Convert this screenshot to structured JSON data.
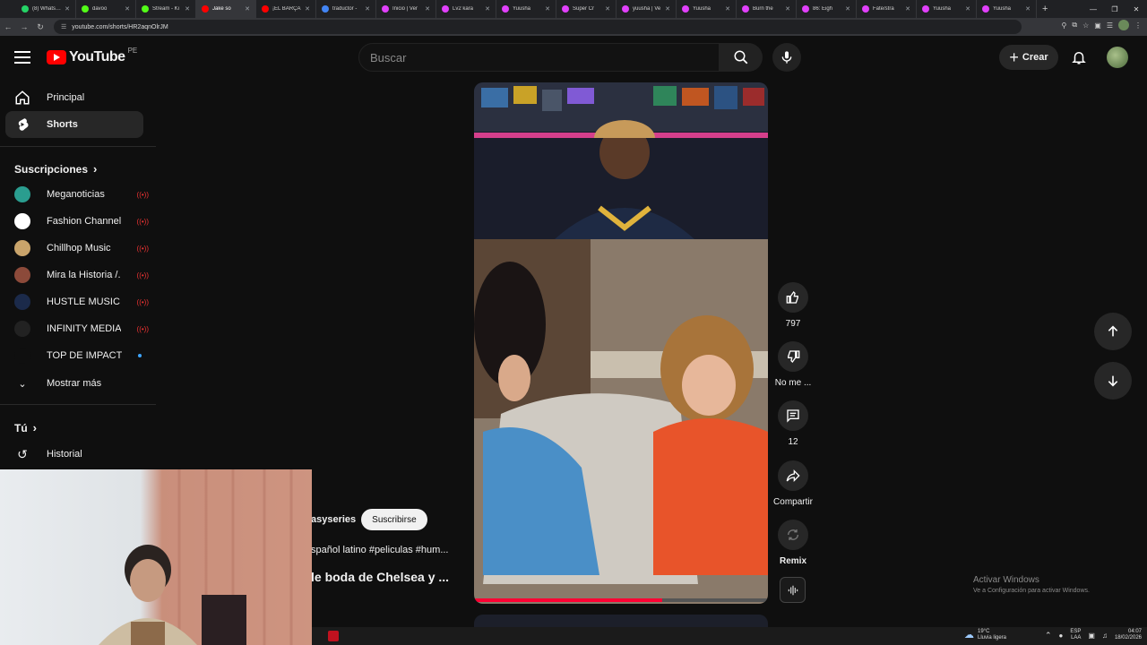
{
  "browser": {
    "tabs": [
      {
        "label": "(8) WhatsApp",
        "color": "#25d366"
      },
      {
        "label": "davoo",
        "color": "#53fc18"
      },
      {
        "label": "Stream - Ki",
        "color": "#53fc18"
      },
      {
        "label": "Jake so",
        "color": "#ff0000",
        "active": true
      },
      {
        "label": "¡EL BARÇA",
        "color": "#ff0000"
      },
      {
        "label": "traductor -",
        "color": "#4285f4"
      },
      {
        "label": "Inicio | Ver",
        "color": "#e040fb"
      },
      {
        "label": "Lv2 kara",
        "color": "#e040fb"
      },
      {
        "label": "Yuusha",
        "color": "#e040fb"
      },
      {
        "label": "Super Cr",
        "color": "#e040fb"
      },
      {
        "label": "yuusha | Ve",
        "color": "#e040fb"
      },
      {
        "label": "Yuusha",
        "color": "#e040fb"
      },
      {
        "label": "Burn the",
        "color": "#e040fb"
      },
      {
        "label": "86: Eigh",
        "color": "#e040fb"
      },
      {
        "label": "Fate/stra",
        "color": "#e040fb"
      },
      {
        "label": "Yuusha",
        "color": "#e040fb"
      },
      {
        "label": "Yuusha",
        "color": "#e040fb"
      }
    ],
    "url": "youtube.com/shorts/HR2aqnOlrJM"
  },
  "header": {
    "logo_text": "YouTube",
    "region": "PE",
    "search_placeholder": "Buscar",
    "create_label": "Crear"
  },
  "sidebar": {
    "main": [
      {
        "label": "Principal",
        "icon": "home-icon"
      },
      {
        "label": "Shorts",
        "icon": "shorts-icon",
        "selected": true
      }
    ],
    "subscriptions_title": "Suscripciones",
    "subscriptions": [
      {
        "name": "Meganoticias",
        "color": "#2a9d8f",
        "status": "live"
      },
      {
        "name": "Fashion Channel",
        "color": "#ffffff",
        "status": "live"
      },
      {
        "name": "Chillhop Music",
        "color": "#c9a46b",
        "status": "live"
      },
      {
        "name": "Mira la Historia /...",
        "color": "#8c4a3a",
        "status": "live"
      },
      {
        "name": "HUSTLE MUSIC (...",
        "color": "#1b2a4a",
        "status": "live"
      },
      {
        "name": "INFINITY MEDIA ...",
        "color": "#222222",
        "status": "live"
      },
      {
        "name": "TOP DE IMPACTO",
        "color": "#0f0f0f",
        "status": "new"
      }
    ],
    "show_more": "Mostrar más",
    "you_title": "Tú",
    "history": "Historial"
  },
  "short": {
    "channel": "asyseries",
    "subscribe_label": "Suscribirse",
    "description": "spañol latino #peliculas #hum...",
    "title": "le boda de Chelsea y ..."
  },
  "actions": {
    "likes": "797",
    "dislike_label": "No me ...",
    "comments": "12",
    "share_label": "Compartir",
    "remix_label": "Remix"
  },
  "watermark": {
    "line1": "Activar Windows",
    "line2": "Ve a Configuración para activar Windows."
  },
  "taskbar": {
    "temperature": "19°C",
    "weather": "Lluvia ligera",
    "lang1": "ESP",
    "lang2": "LAA",
    "time": "04:07",
    "date": "18/02/2026"
  }
}
